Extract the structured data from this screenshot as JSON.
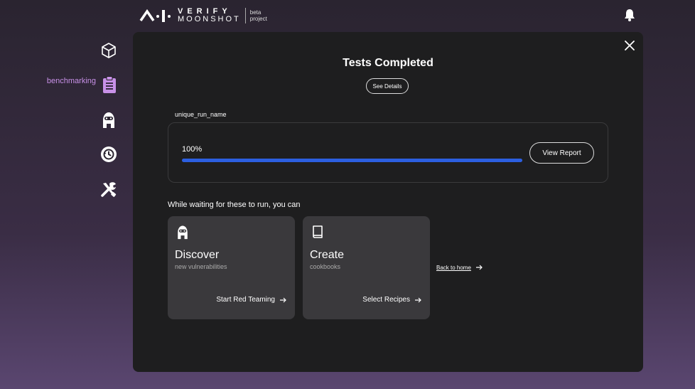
{
  "header": {
    "logo_top": "VERIFY",
    "logo_bottom": "MOONSHOT",
    "logo_beta_1": "beta",
    "logo_beta_2": "project"
  },
  "sidebar": {
    "active_label": "benchmarking"
  },
  "panel": {
    "title": "Tests Completed",
    "see_details": "See Details",
    "run_name": "unique_run_name",
    "progress_text": "100%",
    "progress_value": 100,
    "view_report": "View Report",
    "waiting_text": "While waiting for these to run, you can",
    "cards": [
      {
        "title": "Discover",
        "subtitle": "new vulnerabilities",
        "action": "Start Red Teaming"
      },
      {
        "title": "Create",
        "subtitle": "cookbooks",
        "action": "Select Recipes"
      }
    ],
    "back_home": "Back to home"
  },
  "colors": {
    "accent_purple": "#c891e8",
    "progress_blue": "#2c5fe0"
  }
}
